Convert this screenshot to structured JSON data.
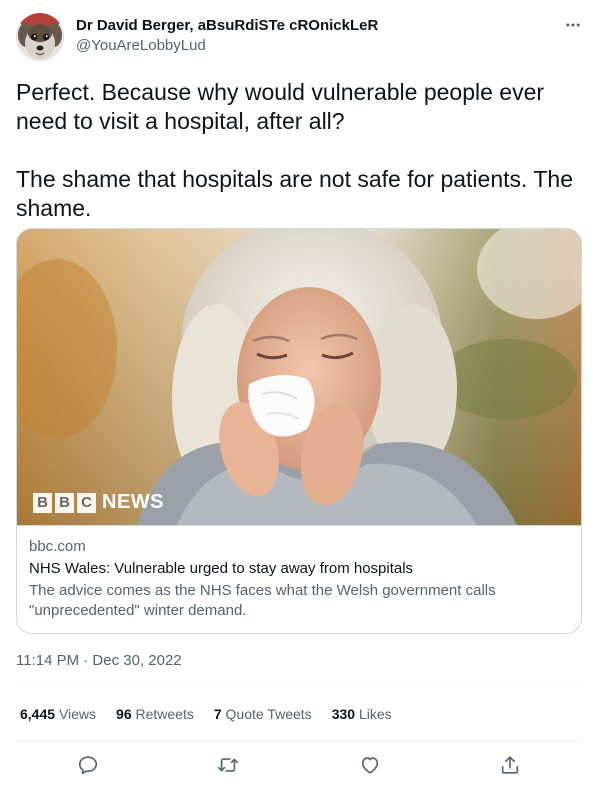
{
  "author": {
    "display_name": "Dr David Berger, aBsuRdiSTe cROnickLeR",
    "handle": "@YouAreLobbyLud",
    "avatar_icon": "dog-avatar"
  },
  "tweet": {
    "paragraphs": [
      "Perfect. Because why would vulnerable people ever need to visit a hospital, after all?",
      "The shame that hospitals are not safe for patients. The shame."
    ]
  },
  "card": {
    "image_icon": "woman-sneezing-photo",
    "logo_letters": [
      "B",
      "B",
      "C"
    ],
    "logo_word": "NEWS",
    "domain": "bbc.com",
    "title": "NHS Wales: Vulnerable urged to stay away from hospitals",
    "description": "The advice comes as the NHS faces what the Welsh government calls \"unprecedented\" winter demand."
  },
  "timestamp": "11:14 PM · Dec 30, 2022",
  "stats": {
    "views": {
      "count": "6,445",
      "label": "Views"
    },
    "retweets": {
      "count": "96",
      "label": "Retweets"
    },
    "quotes": {
      "count": "7",
      "label": "Quote Tweets"
    },
    "likes": {
      "count": "330",
      "label": "Likes"
    }
  },
  "actions": [
    "reply-icon",
    "retweet-icon",
    "like-icon",
    "share-icon"
  ],
  "colors": {
    "text_primary": "#0f1419",
    "text_secondary": "#536471",
    "border": "#cfd9de",
    "divider": "#eff3f4"
  }
}
